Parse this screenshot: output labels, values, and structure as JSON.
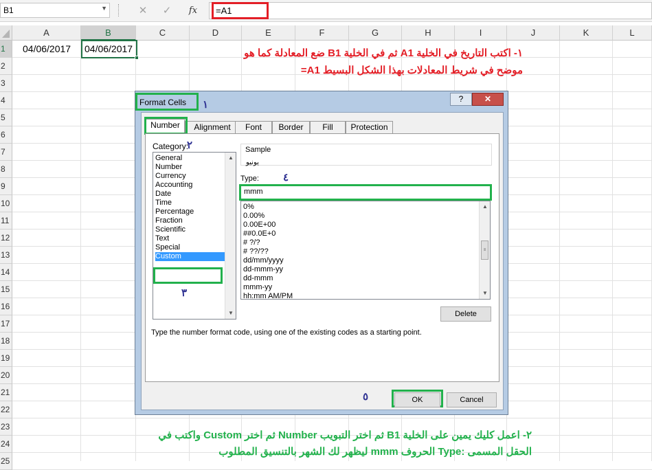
{
  "formula_bar": {
    "name_box": "B1",
    "cancel_icon": "✕",
    "enter_icon": "✓",
    "function_icon": "fx",
    "formula": "=A1"
  },
  "columns": [
    "A",
    "B",
    "C",
    "D",
    "E",
    "F",
    "G",
    "H",
    "I",
    "J",
    "K",
    "L"
  ],
  "rows": [
    "1",
    "2",
    "3",
    "4",
    "5",
    "6",
    "7",
    "8",
    "9",
    "10",
    "11",
    "12",
    "13",
    "14",
    "15",
    "16",
    "17",
    "18",
    "19",
    "20",
    "21",
    "22",
    "23",
    "24",
    "25"
  ],
  "cells": {
    "a1": "04/06/2017",
    "b1": "04/06/2017"
  },
  "annotations": {
    "step1_line1": "١- اكتب التاريخ في الخلية A1 ثم في الخلية B1 ضع المعادلة كما هو",
    "step1_line2": "موضح في شريط المعادلات بهذا الشكل البسيط A1=",
    "step2_line1": "٢- اعمل كليك يمين على الخلية B1 ثم اختر التبويب Number ثم اختر Custom واكتب في",
    "step2_line2": "الحقل المسمى :Type الحروف mmm ليظهر لك الشهر بالتنسيق المطلوب",
    "num1": "١",
    "num2": "٢",
    "num3": "٣",
    "num4": "٤",
    "num5": "٥"
  },
  "dialog": {
    "title": "Format Cells",
    "help": "?",
    "close": "✕",
    "tabs": [
      "Number",
      "Alignment",
      "Font",
      "Border",
      "Fill",
      "Protection"
    ],
    "category_label": "Category:",
    "categories": [
      "General",
      "Number",
      "Currency",
      "Accounting",
      "Date",
      "Time",
      "Percentage",
      "Fraction",
      "Scientific",
      "Text",
      "Special",
      "Custom"
    ],
    "sample_label": "Sample",
    "sample_value": "يونيو",
    "type_label": "Type:",
    "type_value": "mmm",
    "formats": [
      "0%",
      "0.00%",
      "0.00E+00",
      "##0.0E+0",
      "# ?/?",
      "# ??/??",
      "dd/mm/yyyy",
      "dd-mmm-yy",
      "dd-mmm",
      "mmm-yy",
      "hh:mm AM/PM"
    ],
    "delete_label": "Delete",
    "description": "Type the number format code, using one of the existing codes as a starting point.",
    "ok_label": "OK",
    "cancel_label": "Cancel"
  },
  "colors": {
    "excel_green": "#217346",
    "highlight_red": "#e31e26",
    "highlight_green": "#22b14c",
    "number_blue": "#2e3192",
    "selection_blue": "#3399ff"
  }
}
